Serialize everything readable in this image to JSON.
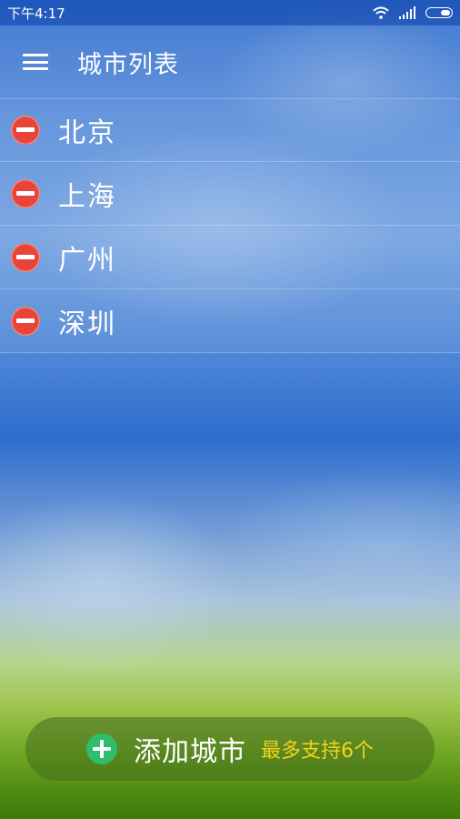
{
  "status_bar": {
    "time": "下午4:17",
    "wifi_icon": "wifi-icon",
    "signal_icon": "signal-icon",
    "battery_icon": "battery-icon"
  },
  "header": {
    "menu_icon": "hamburger-menu-icon",
    "title": "城市列表"
  },
  "cities": [
    {
      "name": "北京",
      "icon": "remove-icon"
    },
    {
      "name": "上海",
      "icon": "remove-icon"
    },
    {
      "name": "广州",
      "icon": "remove-icon"
    },
    {
      "name": "深圳",
      "icon": "remove-icon"
    }
  ],
  "footer": {
    "add_icon": "plus-icon",
    "add_label": "添加城市",
    "limit_note": "最多支持6个"
  },
  "colors": {
    "remove": "#e8453a",
    "add": "#2ebd6b",
    "note": "#f5d21a"
  }
}
